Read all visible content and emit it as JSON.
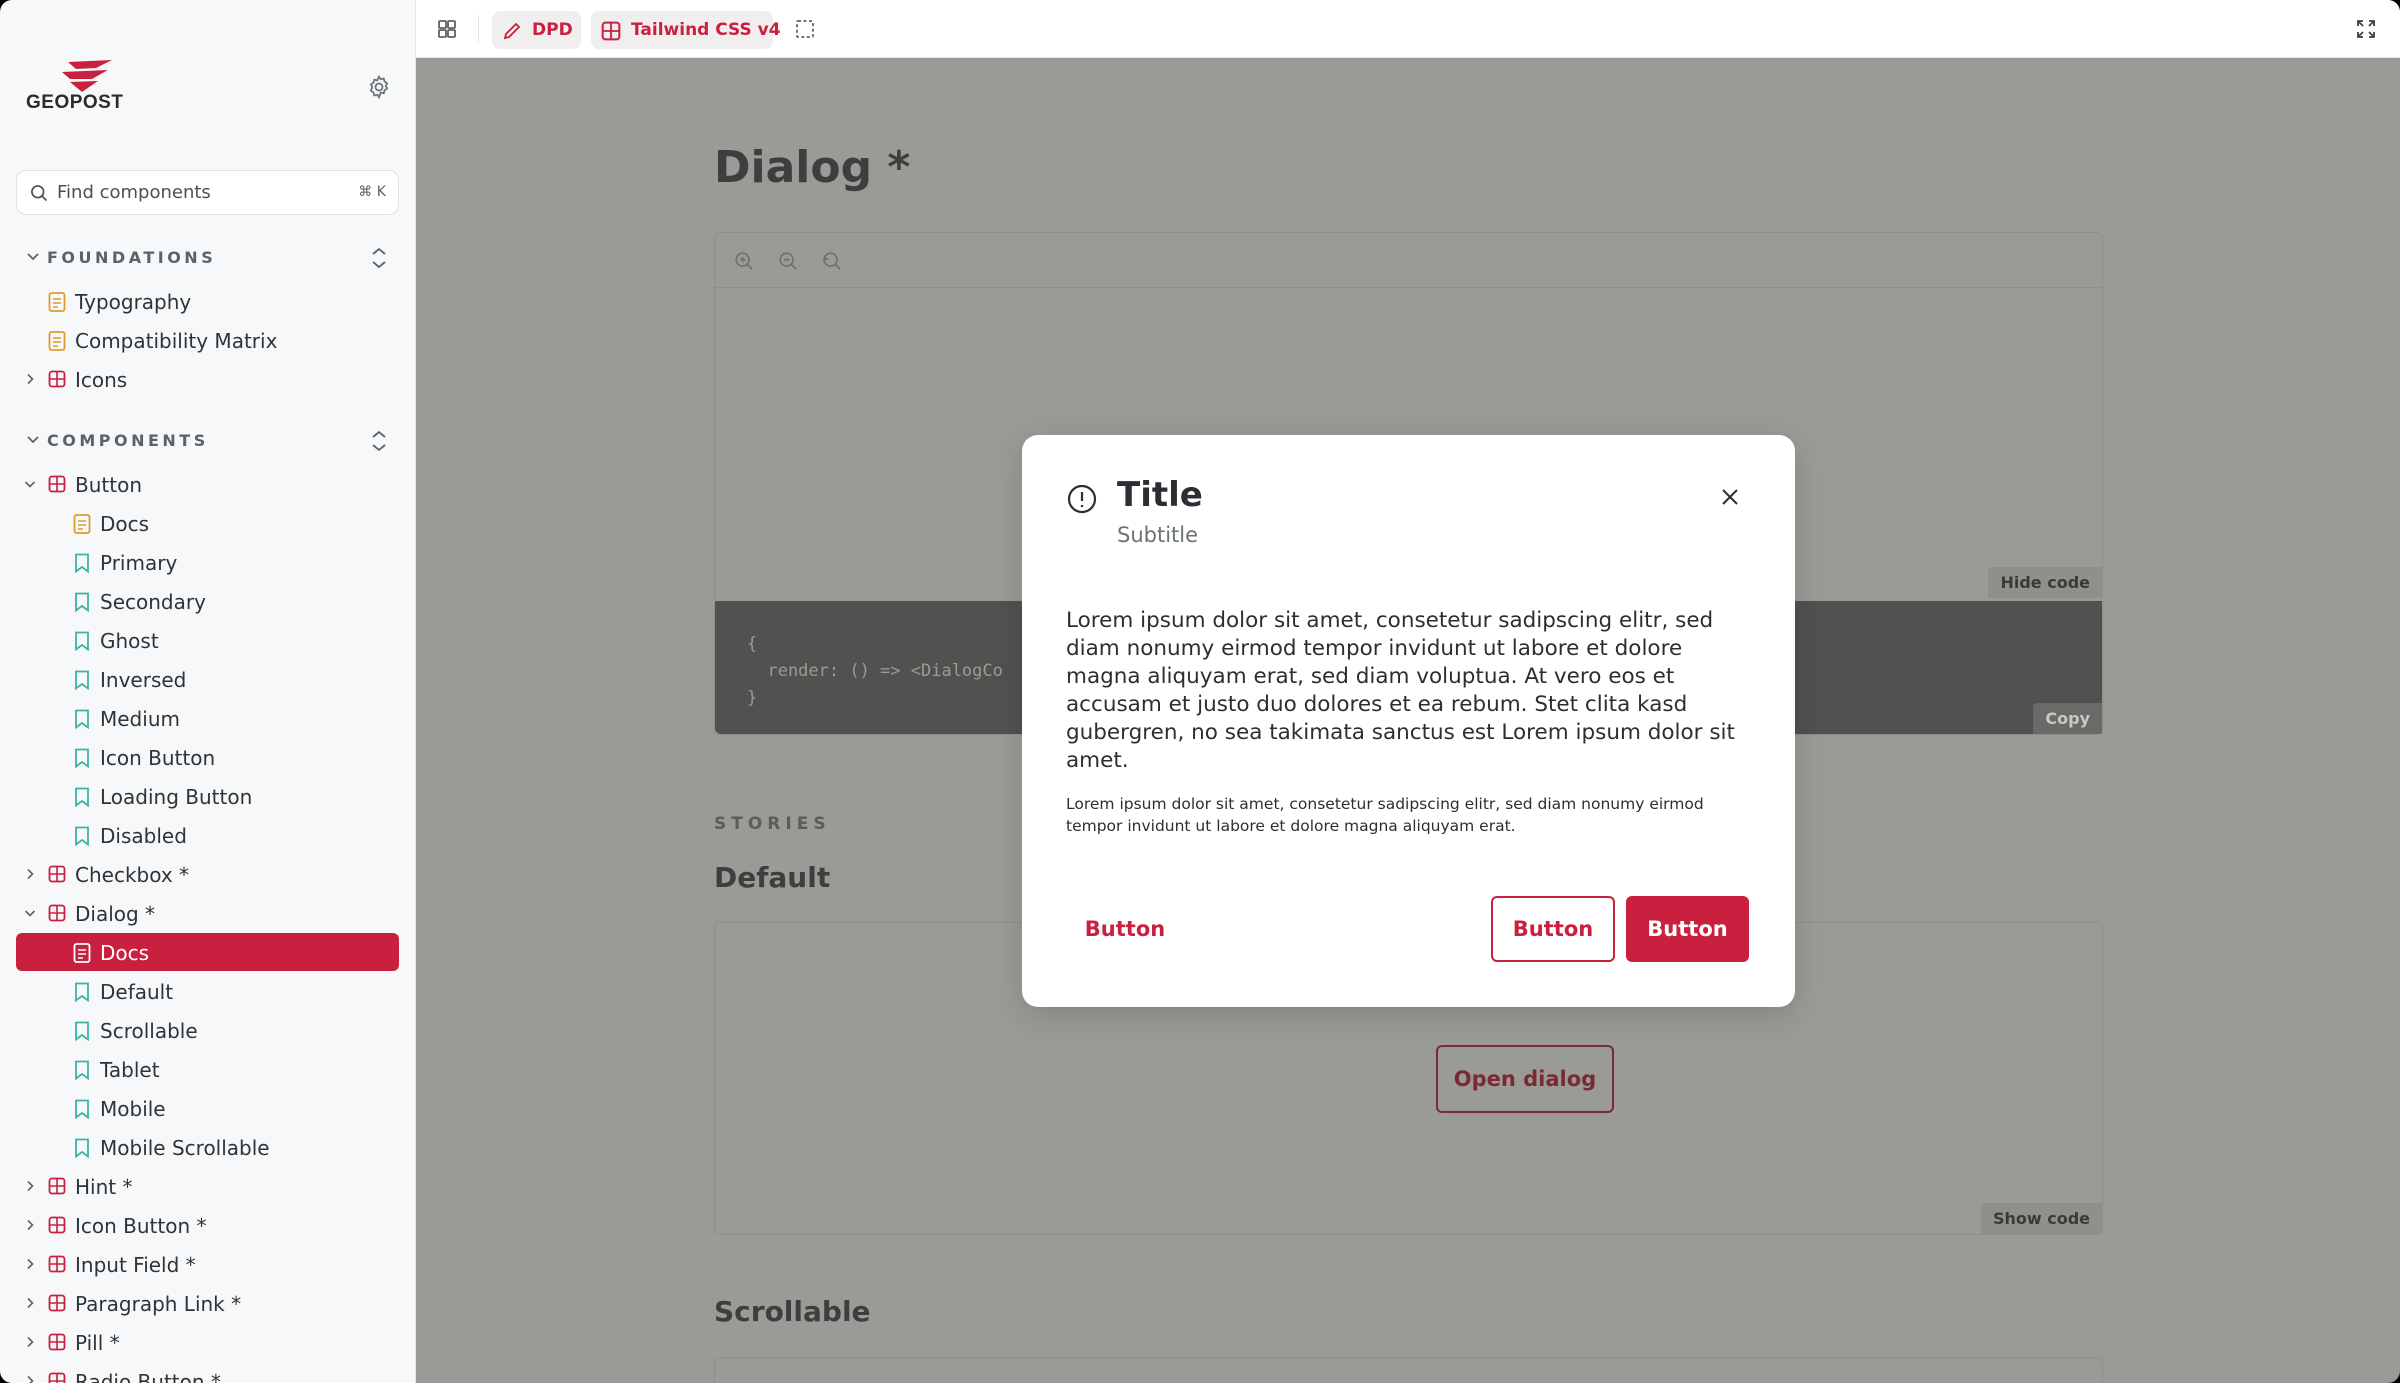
{
  "brand": {
    "logo_text": "GEOPOST",
    "accent": "#c8203e"
  },
  "search": {
    "placeholder": "Find components",
    "shortcut": "⌘ K"
  },
  "sidebar": {
    "foundations": {
      "label": "FOUNDATIONS",
      "items": [
        {
          "label": "Typography",
          "type": "doc"
        },
        {
          "label": "Compatibility Matrix",
          "type": "doc"
        },
        {
          "label": "Icons",
          "type": "component"
        }
      ]
    },
    "components": {
      "label": "COMPONENTS",
      "items": [
        {
          "label": "Button",
          "type": "component"
        },
        {
          "label": "Docs",
          "type": "doc"
        },
        {
          "label": "Primary",
          "type": "story"
        },
        {
          "label": "Secondary",
          "type": "story"
        },
        {
          "label": "Ghost",
          "type": "story"
        },
        {
          "label": "Inversed",
          "type": "story"
        },
        {
          "label": "Medium",
          "type": "story"
        },
        {
          "label": "Icon Button",
          "type": "story"
        },
        {
          "label": "Loading Button",
          "type": "story"
        },
        {
          "label": "Disabled",
          "type": "story"
        },
        {
          "label": "Checkbox *",
          "type": "component"
        },
        {
          "label": "Dialog *",
          "type": "component"
        },
        {
          "label": "Docs",
          "type": "doc",
          "selected": true
        },
        {
          "label": "Default",
          "type": "story"
        },
        {
          "label": "Scrollable",
          "type": "story"
        },
        {
          "label": "Tablet",
          "type": "story"
        },
        {
          "label": "Mobile",
          "type": "story"
        },
        {
          "label": "Mobile Scrollable",
          "type": "story"
        },
        {
          "label": "Hint *",
          "type": "component"
        },
        {
          "label": "Icon Button *",
          "type": "component"
        },
        {
          "label": "Input Field *",
          "type": "component"
        },
        {
          "label": "Paragraph Link *",
          "type": "component"
        },
        {
          "label": "Pill *",
          "type": "component"
        },
        {
          "label": "Radio Button *",
          "type": "component"
        }
      ]
    }
  },
  "toolbar": {
    "brand_pill": "DPD",
    "theme_pill": "Tailwind CSS v4"
  },
  "main": {
    "title": "Dialog *",
    "code_lines": [
      "{",
      "  render: () => <DialogCo",
      "}"
    ],
    "hide_code": "Hide code",
    "copy": "Copy",
    "stories_label": "STORIES",
    "default_title": "Default",
    "open_dialog": "Open dialog",
    "show_code": "Show code",
    "scrollable_title": "Scrollable"
  },
  "dialog": {
    "title": "Title",
    "subtitle": "Subtitle",
    "body": "Lorem ipsum dolor sit amet, consetetur sadipscing elitr, sed diam nonumy eirmod tempor invidunt ut labore et dolore magna aliquyam erat, sed diam voluptua. At vero eos et accusam et justo duo dolores et ea rebum. Stet clita kasd gubergren, no sea takimata sanctus est Lorem ipsum dolor sit amet.",
    "small": "Lorem ipsum dolor sit amet, consetetur sadipscing elitr, sed diam nonumy eirmod tempor invidunt ut labore et dolore magna aliquyam erat.",
    "button_ghost": "Button",
    "button_outline": "Button",
    "button_primary": "Button"
  }
}
